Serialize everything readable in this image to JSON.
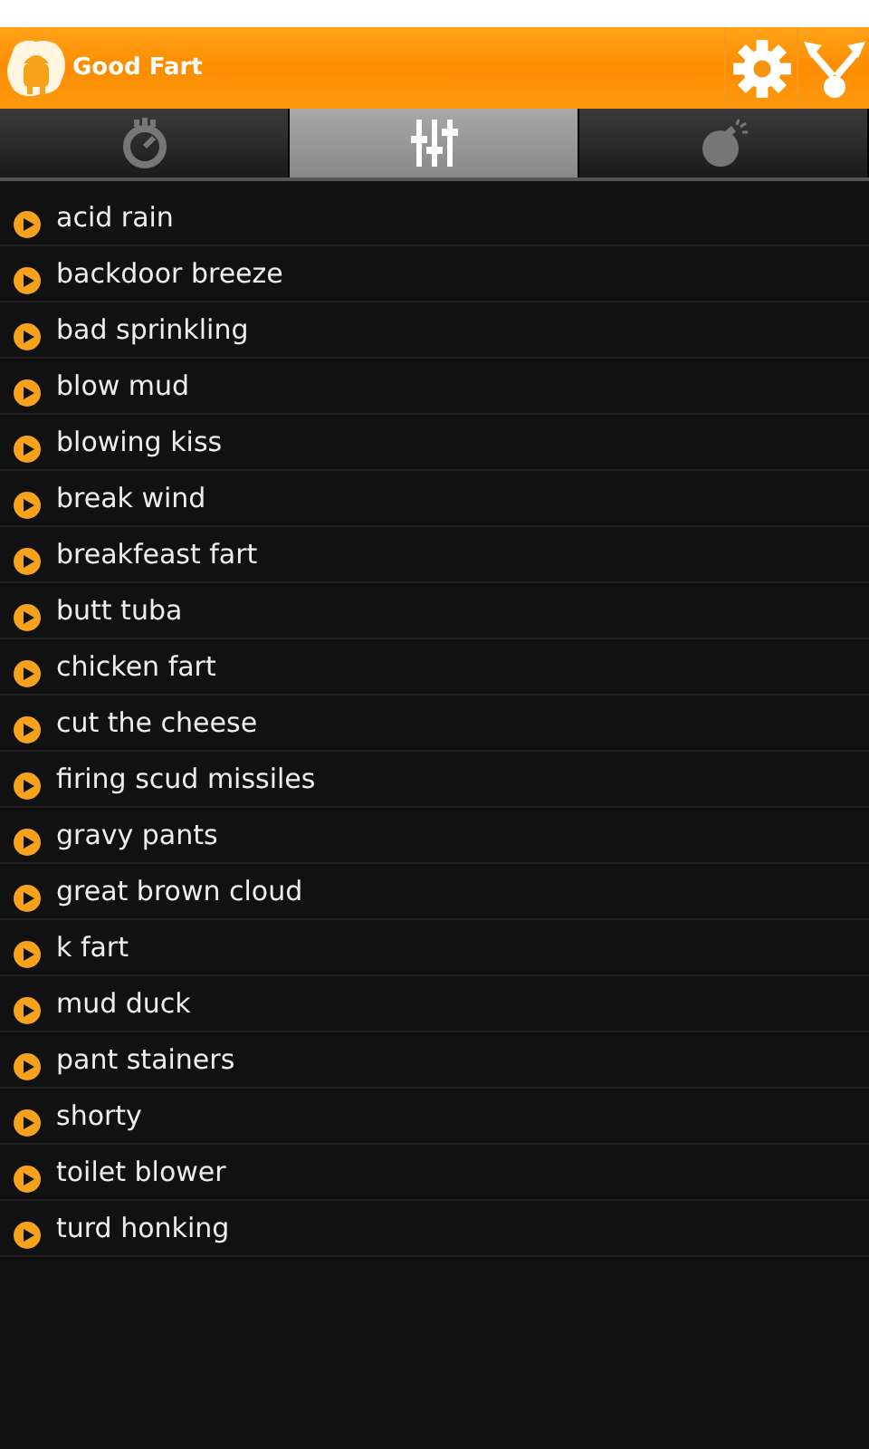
{
  "app_bar": {
    "title": "Good Fart"
  },
  "tabs": [
    {
      "kind": "timer",
      "selected": false
    },
    {
      "kind": "sliders",
      "selected": true
    },
    {
      "kind": "bomb",
      "selected": false
    }
  ],
  "sounds": [
    "acid rain",
    "backdoor breeze",
    "bad sprinkling",
    "blow mud",
    "blowing kiss",
    "break wind",
    "breakfeast fart",
    "butt tuba",
    "chicken fart",
    "cut the cheese",
    "firing scud missiles",
    "gravy pants",
    "great brown cloud",
    "k fart",
    "mud duck",
    "pant stainers",
    "shorty",
    "toilet blower",
    "turd honking"
  ]
}
